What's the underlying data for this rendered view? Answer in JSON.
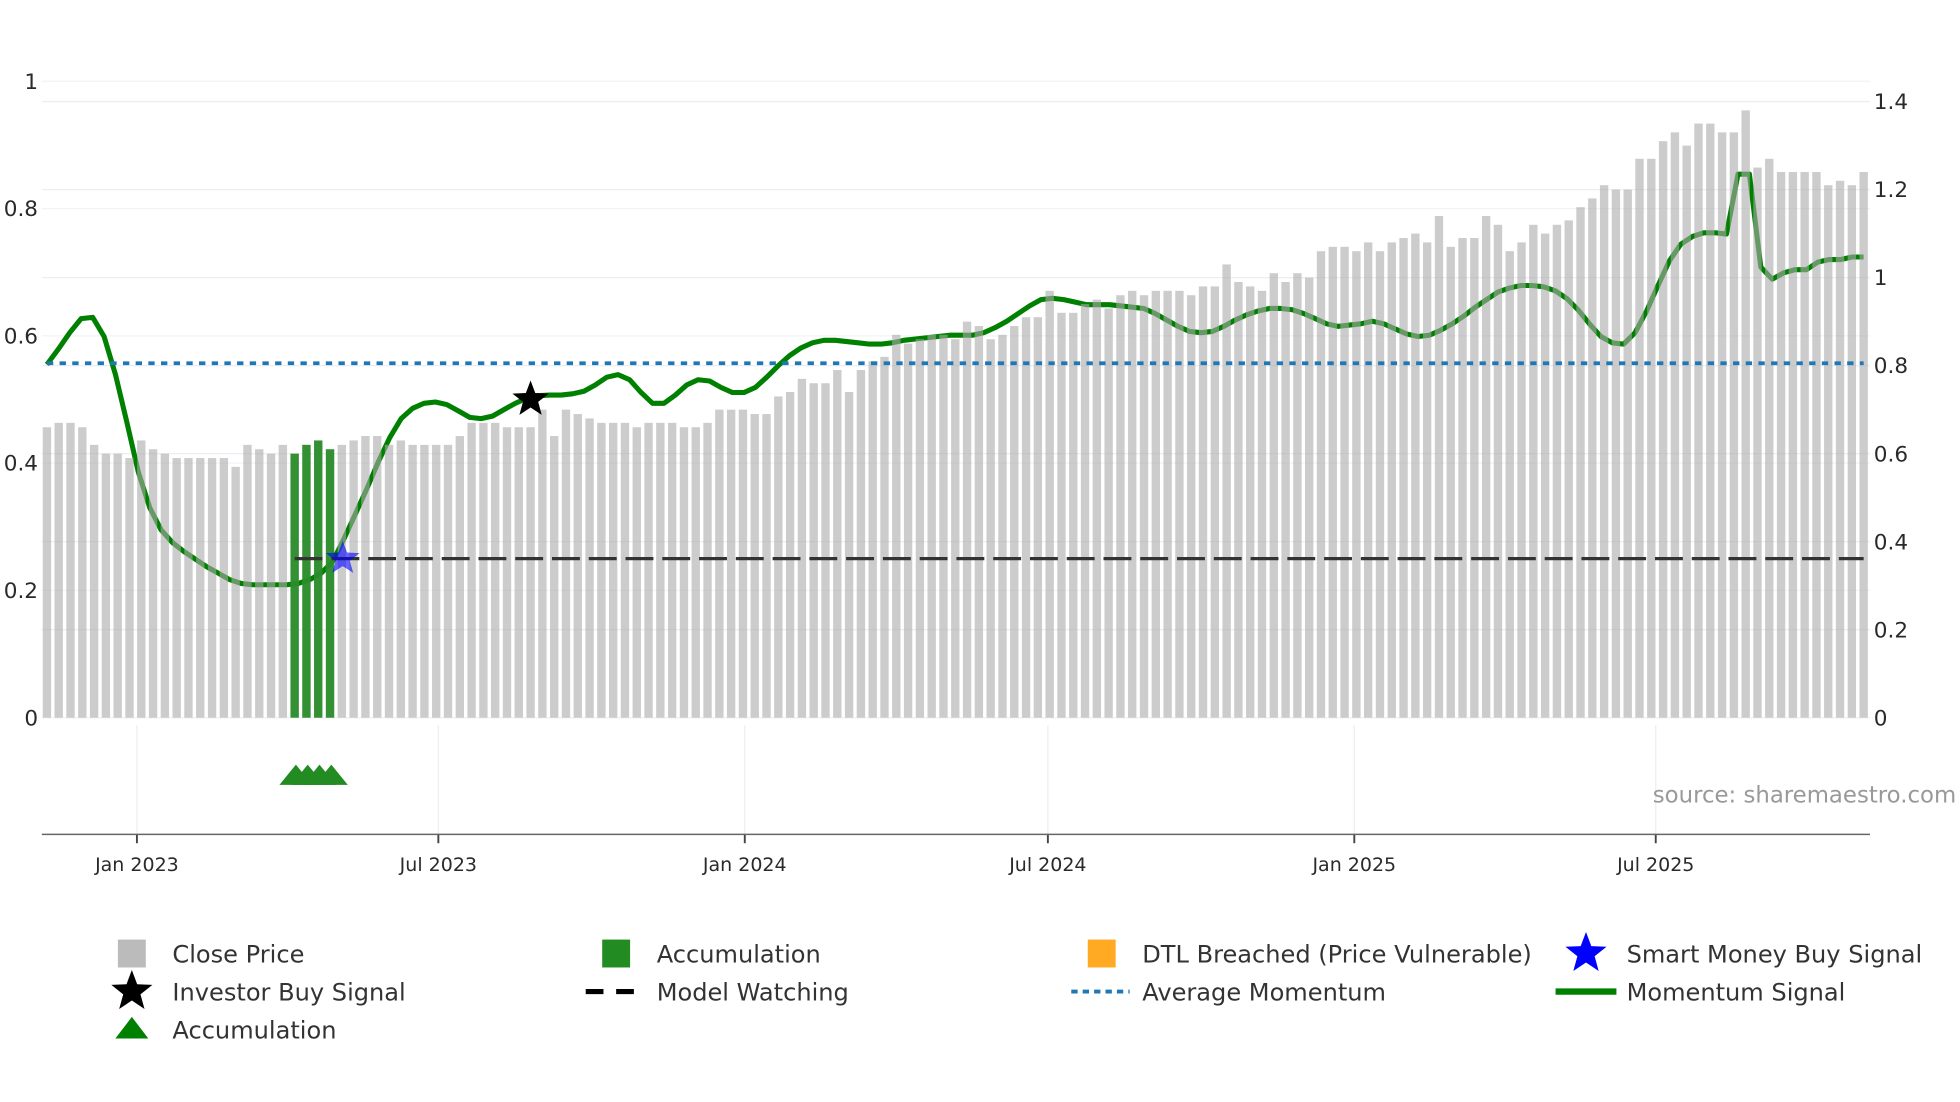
{
  "chart_data": {
    "type": "bar",
    "frequency": "weekly",
    "y_left": {
      "ticks": [
        "0",
        "0.2",
        "0.4",
        "0.6",
        "0.8",
        "1"
      ],
      "range": [
        0,
        1
      ]
    },
    "y_right": {
      "ticks": [
        "0",
        "0.2",
        "0.4",
        "0.6",
        "0.8",
        "1",
        "1.2",
        "1.4"
      ],
      "range": [
        0,
        1.4
      ]
    },
    "x_ticks": [
      {
        "label": "Jan 2023",
        "date": "2023-01-01"
      },
      {
        "label": "Jul 2023",
        "date": "2023-07-01"
      },
      {
        "label": "Jan 2024",
        "date": "2024-01-01"
      },
      {
        "label": "Jul 2024",
        "date": "2024-07-01"
      },
      {
        "label": "Jan 2025",
        "date": "2025-01-01"
      },
      {
        "label": "Jul 2025",
        "date": "2025-07-01"
      }
    ],
    "close_price": [
      0.66,
      0.67,
      0.67,
      0.66,
      0.62,
      0.6,
      0.6,
      0.59,
      0.63,
      0.61,
      0.6,
      0.59,
      0.59,
      0.59,
      0.59,
      0.59,
      0.57,
      0.62,
      0.61,
      0.6,
      0.62,
      0.6,
      0.62,
      0.63,
      0.61,
      0.62,
      0.63,
      0.64,
      0.64,
      0.62,
      0.63,
      0.62,
      0.62,
      0.62,
      0.62,
      0.64,
      0.67,
      0.67,
      0.67,
      0.66,
      0.66,
      0.66,
      0.7,
      0.64,
      0.7,
      0.69,
      0.68,
      0.67,
      0.67,
      0.67,
      0.66,
      0.67,
      0.67,
      0.67,
      0.66,
      0.66,
      0.67,
      0.7,
      0.7,
      0.7,
      0.69,
      0.69,
      0.73,
      0.74,
      0.77,
      0.76,
      0.76,
      0.79,
      0.74,
      0.79,
      0.81,
      0.82,
      0.87,
      0.85,
      0.86,
      0.87,
      0.87,
      0.86,
      0.9,
      0.89,
      0.86,
      0.87,
      0.89,
      0.91,
      0.91,
      0.97,
      0.92,
      0.92,
      0.94,
      0.95,
      0.93,
      0.96,
      0.97,
      0.96,
      0.97,
      0.97,
      0.97,
      0.96,
      0.98,
      0.98,
      1.03,
      0.99,
      0.98,
      0.97,
      1.01,
      0.99,
      1.01,
      1.0,
      1.06,
      1.07,
      1.07,
      1.06,
      1.08,
      1.06,
      1.08,
      1.09,
      1.1,
      1.08,
      1.14,
      1.07,
      1.09,
      1.09,
      1.14,
      1.12,
      1.06,
      1.08,
      1.12,
      1.1,
      1.12,
      1.13,
      1.16,
      1.18,
      1.21,
      1.2,
      1.2,
      1.27,
      1.27,
      1.31,
      1.33,
      1.3,
      1.35,
      1.35,
      1.33,
      1.33,
      1.38,
      1.25,
      1.27,
      1.24,
      1.24,
      1.24,
      1.24,
      1.21,
      1.22,
      1.21,
      1.24
    ],
    "accumulation_bar_indices": [
      21,
      22,
      23,
      24
    ],
    "momentum_signal": [
      0.555,
      0.579,
      0.605,
      0.627,
      0.629,
      0.599,
      0.539,
      0.464,
      0.386,
      0.33,
      0.295,
      0.275,
      0.261,
      0.249,
      0.237,
      0.227,
      0.217,
      0.211,
      0.209,
      0.209,
      0.209,
      0.209,
      0.211,
      0.217,
      0.227,
      0.245,
      0.281,
      0.32,
      0.36,
      0.402,
      0.44,
      0.47,
      0.486,
      0.494,
      0.496,
      0.492,
      0.482,
      0.472,
      0.47,
      0.474,
      0.484,
      0.494,
      0.502,
      0.506,
      0.507,
      0.507,
      0.509,
      0.513,
      0.523,
      0.535,
      0.539,
      0.531,
      0.511,
      0.494,
      0.494,
      0.507,
      0.523,
      0.531,
      0.529,
      0.519,
      0.511,
      0.511,
      0.519,
      0.535,
      0.553,
      0.569,
      0.581,
      0.589,
      0.593,
      0.593,
      0.591,
      0.589,
      0.587,
      0.587,
      0.589,
      0.593,
      0.595,
      0.597,
      0.599,
      0.601,
      0.601,
      0.601,
      0.605,
      0.613,
      0.623,
      0.635,
      0.647,
      0.657,
      0.659,
      0.657,
      0.653,
      0.649,
      0.649,
      0.649,
      0.647,
      0.645,
      0.643,
      0.635,
      0.625,
      0.615,
      0.607,
      0.605,
      0.607,
      0.615,
      0.625,
      0.633,
      0.639,
      0.643,
      0.643,
      0.641,
      0.635,
      0.627,
      0.619,
      0.615,
      0.617,
      0.619,
      0.623,
      0.619,
      0.611,
      0.603,
      0.599,
      0.601,
      0.609,
      0.619,
      0.631,
      0.645,
      0.657,
      0.669,
      0.675,
      0.679,
      0.679,
      0.677,
      0.671,
      0.659,
      0.641,
      0.619,
      0.599,
      0.589,
      0.587,
      0.605,
      0.639,
      0.679,
      0.718,
      0.744,
      0.756,
      0.762,
      0.762,
      0.76,
      0.854,
      0.854,
      0.708,
      0.689,
      0.699,
      0.704,
      0.704,
      0.716,
      0.72,
      0.72,
      0.724,
      0.724
    ],
    "average_momentum": 0.557,
    "model_watching": {
      "value": 0.25,
      "start_bar_index": 21
    },
    "smart_money_buy_signal": {
      "bar_index": 24,
      "value": 0.25
    },
    "investor_buy_signal": {
      "bar_index": 41,
      "value": 0.5
    },
    "accumulation_markers_bar_indices": [
      21,
      22,
      23,
      24
    ],
    "colors": {
      "close_price": "#cccccc",
      "accumulation": "#228b22",
      "dtl_breached": "#ffa500",
      "smart_money": "#0000ff",
      "investor": "#000000",
      "average_momentum": "#1f77b4",
      "momentum": "#008000"
    },
    "legend": {
      "placement": "bottom",
      "items": [
        {
          "label": "Close Price",
          "icon": "gray-square"
        },
        {
          "label": "Accumulation",
          "icon": "green-square"
        },
        {
          "label": "DTL Breached (Price Vulnerable)",
          "icon": "orange-square"
        },
        {
          "label": "Smart Money Buy Signal",
          "icon": "blue-star"
        },
        {
          "label": "Investor Buy Signal",
          "icon": "black-star"
        },
        {
          "label": "Model Watching",
          "icon": "black-dash"
        },
        {
          "label": "Average Momentum",
          "icon": "blue-dots"
        },
        {
          "label": "Momentum Signal",
          "icon": "green-line"
        },
        {
          "label": "Accumulation",
          "icon": "green-triangle"
        }
      ]
    },
    "source": "source: sharemaestro.com"
  }
}
